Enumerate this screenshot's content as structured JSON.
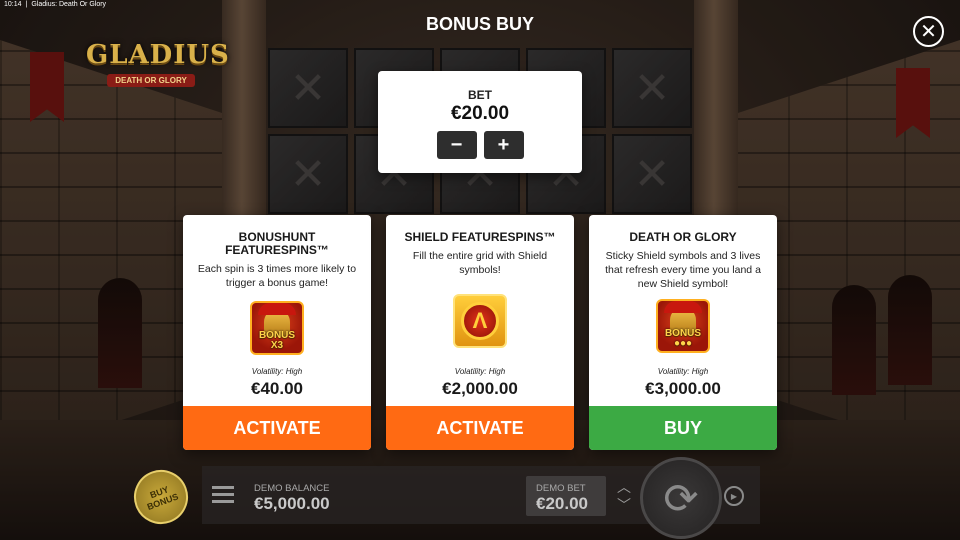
{
  "status_bar": {
    "time": "10:14",
    "page_title": "Gladius: Death Or Glory"
  },
  "logo": {
    "title": "GLADIUS",
    "subtitle": "DEATH OR GLORY"
  },
  "header": {
    "title": "BONUS BUY",
    "close_symbol": "✕"
  },
  "bet": {
    "label": "BET",
    "value": "€20.00",
    "minus": "−",
    "plus": "+"
  },
  "cards": [
    {
      "title": "BONUSHUNT FEATURESPINS™",
      "description": "Each spin is 3 times more likely to trigger a bonus game!",
      "icon": "helmet-bonus-x3-icon",
      "icon_tag": "BONUS X3",
      "volatility": "Volatility: High",
      "price": "€40.00",
      "button": "ACTIVATE",
      "button_color": "#ff6a13"
    },
    {
      "title": "SHIELD FEATURESPINS™",
      "description": "Fill the entire grid with Shield symbols!",
      "icon": "shield-icon",
      "icon_tag": "",
      "volatility": "Volatility: High",
      "price": "€2,000.00",
      "button": "ACTIVATE",
      "button_color": "#ff6a13"
    },
    {
      "title": "DEATH OR GLORY",
      "description": "Sticky Shield symbols and 3 lives that refresh every time you land a new Shield symbol!",
      "icon": "helmet-bonus-lives-icon",
      "icon_tag": "BONUS ●●●",
      "volatility": "Volatility: High",
      "price": "€3,000.00",
      "button": "BUY",
      "button_color": "#3caa44"
    }
  ],
  "bottom_bar": {
    "buy_bonus": "BUY BONUS",
    "balance_label": "DEMO BALANCE",
    "balance_value": "€5,000.00",
    "bet_label": "DEMO BET",
    "bet_value": "€20.00"
  }
}
